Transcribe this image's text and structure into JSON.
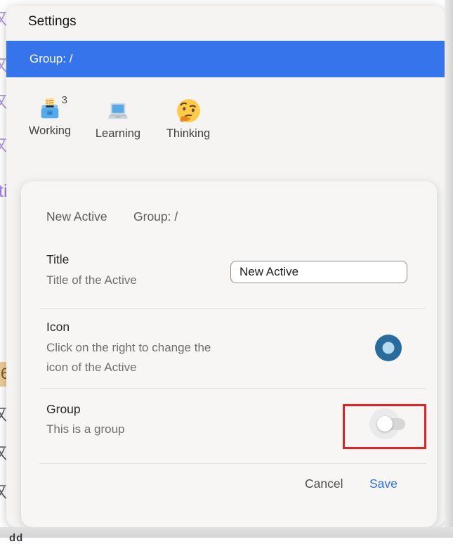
{
  "window": {
    "title": "Settings"
  },
  "group_bar": {
    "label": "Group: /"
  },
  "actives": [
    {
      "label": "Working",
      "icon": "ballot-box-emoji",
      "badge": "3"
    },
    {
      "label": "Learning",
      "icon": "laptop-emoji"
    },
    {
      "label": "Thinking",
      "icon": "thinking-face-emoji"
    }
  ],
  "dialog": {
    "title": "New Active",
    "group_label": "Group: /",
    "fields": [
      {
        "name": "title",
        "label": "Title",
        "description": "Title of the Active",
        "value": "New Active"
      },
      {
        "name": "icon",
        "label": "Icon",
        "description": "Click on the right to change the icon of the Active",
        "icon": "radio-button-icon"
      },
      {
        "name": "group",
        "label": "Group",
        "description": "This is a group",
        "toggle_state": "off",
        "annotation": "red-highlight-box"
      }
    ],
    "buttons": {
      "cancel": "Cancel",
      "save": "Save"
    }
  },
  "background": {
    "partial_word": "ti",
    "highlighted_number": "6",
    "bottom_text_fragment": "dd"
  },
  "colors": {
    "accent_blue": "#3674ec",
    "save_blue": "#2e6fe3",
    "annotation_red": "#df2423",
    "radio_outer_blue": "#2a6b9e",
    "radio_inner_blue": "#b7d9f2"
  }
}
